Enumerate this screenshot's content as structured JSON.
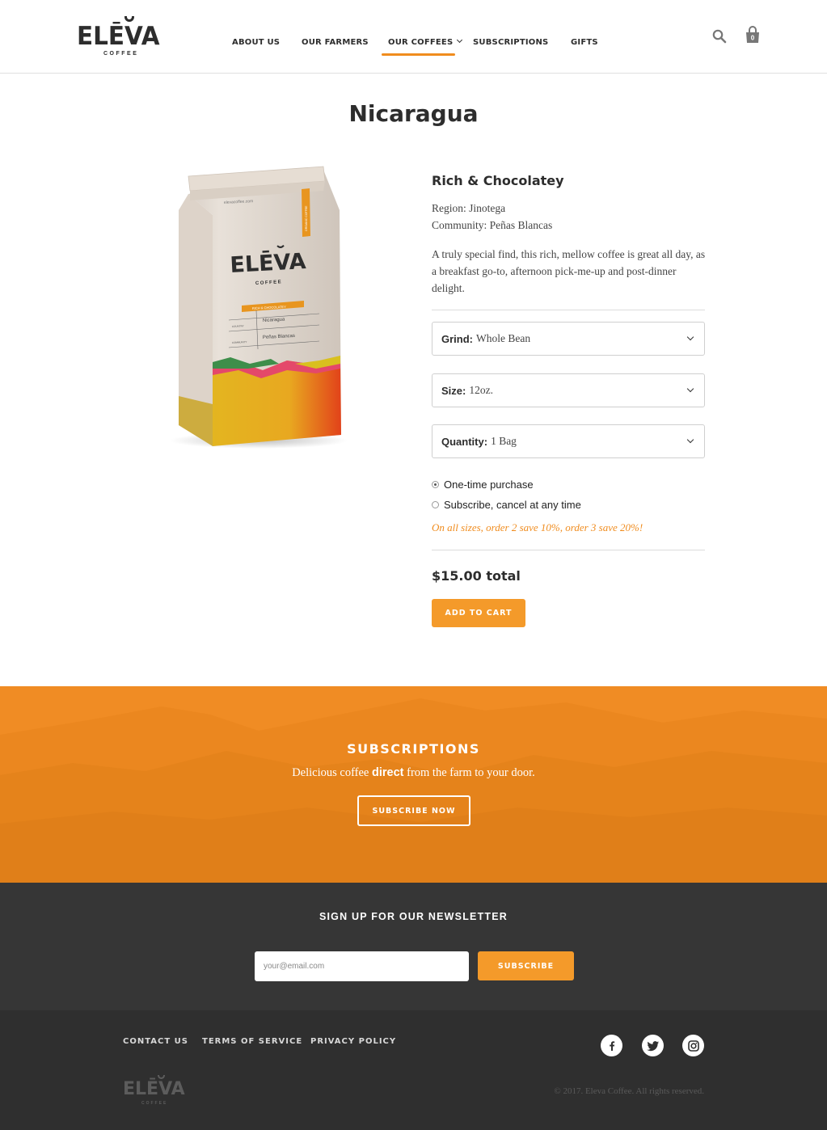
{
  "brand": {
    "logo_text": "ELĚVA",
    "logo_sub": "COFFEE"
  },
  "nav": {
    "items": [
      {
        "label": "ABOUT US"
      },
      {
        "label": "OUR FARMERS"
      },
      {
        "label": "OUR COFFEES"
      },
      {
        "label": "SUBSCRIPTIONS"
      },
      {
        "label": "GIFTS"
      }
    ],
    "active": "OUR COFFEES",
    "cart_count": "0"
  },
  "product": {
    "title": "Nicaragua",
    "subtitle": "Rich & Chocolatey",
    "region": "Region: Jinotega",
    "community": "Community: Peñas Blancas",
    "description": "A truly special find, this rich, mellow coffee is great all day, as a breakfast go-to, afternoon pick-me-up and post-dinner delight.",
    "bag": {
      "site": "elevacoffee.com",
      "brand": "ELĚVA",
      "sub": "COFFEE",
      "flavor": "RICH & CHOCOLATEY",
      "side_label": "ORGANIC COFFEE",
      "country_label": "COUNTRY",
      "country": "Nicaragua",
      "community_label": "COMMUNITY",
      "community": "Peñas Blancas"
    },
    "options": {
      "grind": {
        "label": "Grind:",
        "value": "Whole Bean"
      },
      "size": {
        "label": "Size:",
        "value": "12oz."
      },
      "quantity": {
        "label": "Quantity:",
        "value": "1 Bag"
      }
    },
    "purchase_options": [
      {
        "label": "One-time purchase",
        "checked": true
      },
      {
        "label": "Subscribe, cancel at any time",
        "checked": false
      }
    ],
    "promo": "On all sizes, order 2 save 10%, order 3 save 20%!",
    "price": "$15.00 total",
    "add_to_cart": "ADD TO CART"
  },
  "subscriptions": {
    "title": "SUBSCRIPTIONS",
    "text_before": "Delicious coffee ",
    "text_bold": "direct",
    "text_after": " from the farm to your door.",
    "button": "SUBSCRIBE NOW"
  },
  "newsletter": {
    "title": "SIGN UP FOR OUR NEWSLETTER",
    "placeholder": "your@email.com",
    "button": "SUBSCRIBE"
  },
  "footer": {
    "links": [
      "CONTACT US",
      "TERMS OF SERVICE",
      "PRIVACY POLICY"
    ],
    "social": [
      "facebook-icon",
      "twitter-icon",
      "instagram-icon"
    ],
    "logo_text": "ELĚVA",
    "logo_sub": "COFFEE",
    "copyright": "© 2017. Eleva Coffee. All rights reserved."
  },
  "colors": {
    "accent": "#f08c1e",
    "dark": "#363636",
    "footer": "#2f2f2f",
    "text": "#2d2d2d"
  }
}
